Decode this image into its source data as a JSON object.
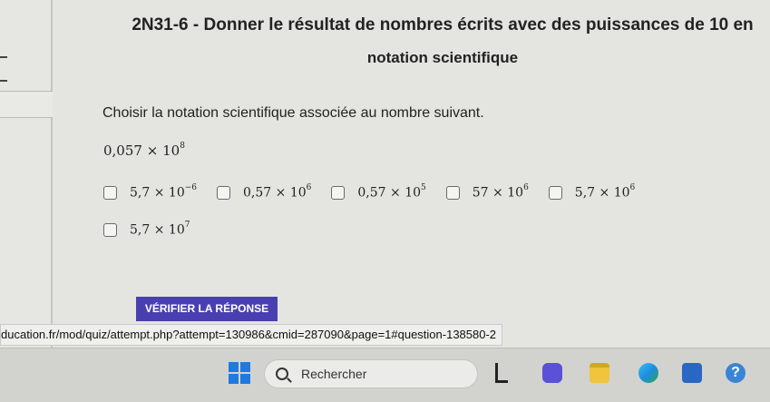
{
  "question": {
    "title_line1": "2N31-6 - Donner le résultat de nombres écrits avec des puissances de 10 en",
    "title_line2": "notation scientifique",
    "prompt": "Choisir la notation scientifique associée au nombre suivant.",
    "number": {
      "mantissa": "0,057",
      "times": "×",
      "base": "10",
      "exponent": "8"
    }
  },
  "options": [
    {
      "mantissa": "5,7",
      "times": "×",
      "base": "10",
      "exponent": "−6"
    },
    {
      "mantissa": "0,57",
      "times": "×",
      "base": "10",
      "exponent": "6"
    },
    {
      "mantissa": "0,57",
      "times": "×",
      "base": "10",
      "exponent": "5"
    },
    {
      "mantissa": "57",
      "times": "×",
      "base": "10",
      "exponent": "6"
    },
    {
      "mantissa": "5,7",
      "times": "×",
      "base": "10",
      "exponent": "6"
    },
    {
      "mantissa": "5,7",
      "times": "×",
      "base": "10",
      "exponent": "7"
    }
  ],
  "verify_button": "VÉRIFIER LA RÉPONSE",
  "status_url": "ducation.fr/mod/quiz/attempt.php?attempt=130986&cmid=287090&page=1#question-138580-2",
  "taskbar": {
    "search_label": "Rechercher",
    "help_glyph": "?"
  },
  "colors": {
    "button": "#4a3fb0",
    "windows_blue": "#1f7ae0"
  }
}
